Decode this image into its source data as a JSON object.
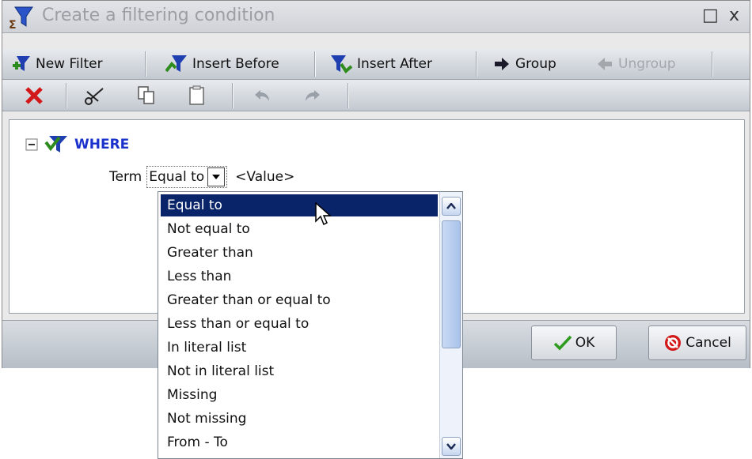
{
  "window": {
    "title": "Create a filtering condition",
    "restore_glyph": "□",
    "close_glyph": "x"
  },
  "toolbar1": {
    "new_filter": "New Filter",
    "insert_before": "Insert Before",
    "insert_after": "Insert After",
    "group": "Group",
    "ungroup": "Ungroup"
  },
  "toolbar2": {
    "icons": [
      "delete-icon",
      "cut-icon",
      "copy-icon",
      "paste-icon",
      "undo-icon",
      "redo-icon"
    ]
  },
  "condition": {
    "keyword": "WHERE",
    "field": "Term",
    "operator": "Equal to",
    "value_placeholder": "<Value>"
  },
  "dropdown": {
    "selected_index": 0,
    "options": [
      "Equal to",
      "Not equal to",
      "Greater than",
      "Less than",
      "Greater than or equal to",
      "Less than or equal to",
      "In literal list",
      "Not in literal list",
      "Missing",
      "Not missing",
      "From - To"
    ]
  },
  "footer": {
    "ok": "OK",
    "cancel": "Cancel"
  },
  "colors": {
    "selection": "#0a246a",
    "where_keyword": "#1a31cc",
    "filter_green": "#2e8b1e",
    "filter_blue": "#1f3fb0"
  }
}
